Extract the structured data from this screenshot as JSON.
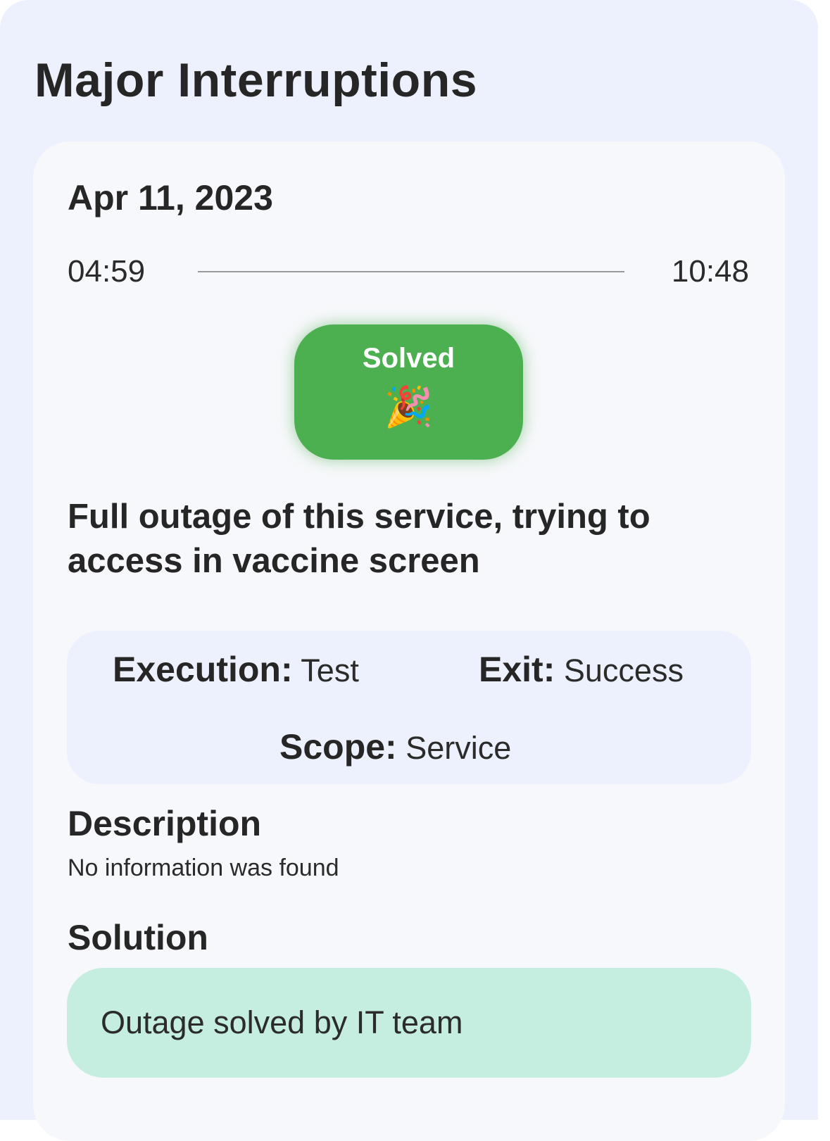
{
  "page": {
    "title": "Major Interruptions"
  },
  "incident": {
    "date": "Apr 11, 2023",
    "start_time": "04:59",
    "end_time": "10:48",
    "status": {
      "label": "Solved",
      "emoji": "🎉",
      "icon": "party-popper-icon",
      "color": "#4caf50"
    },
    "headline": "Full outage of this service, trying to access in vaccine screen",
    "meta": {
      "execution_label": "Execution:",
      "execution_value": "Test",
      "exit_label": "Exit:",
      "exit_value": "Success",
      "scope_label": "Scope:",
      "scope_value": "Service"
    },
    "description": {
      "title": "Description",
      "text": "No information was found"
    },
    "solution": {
      "title": "Solution",
      "text": "Outage solved by IT team",
      "color": "#c5ede0"
    }
  },
  "colors": {
    "background": "#edf1fe",
    "card": "#f7f8fb",
    "text": "#262626"
  }
}
